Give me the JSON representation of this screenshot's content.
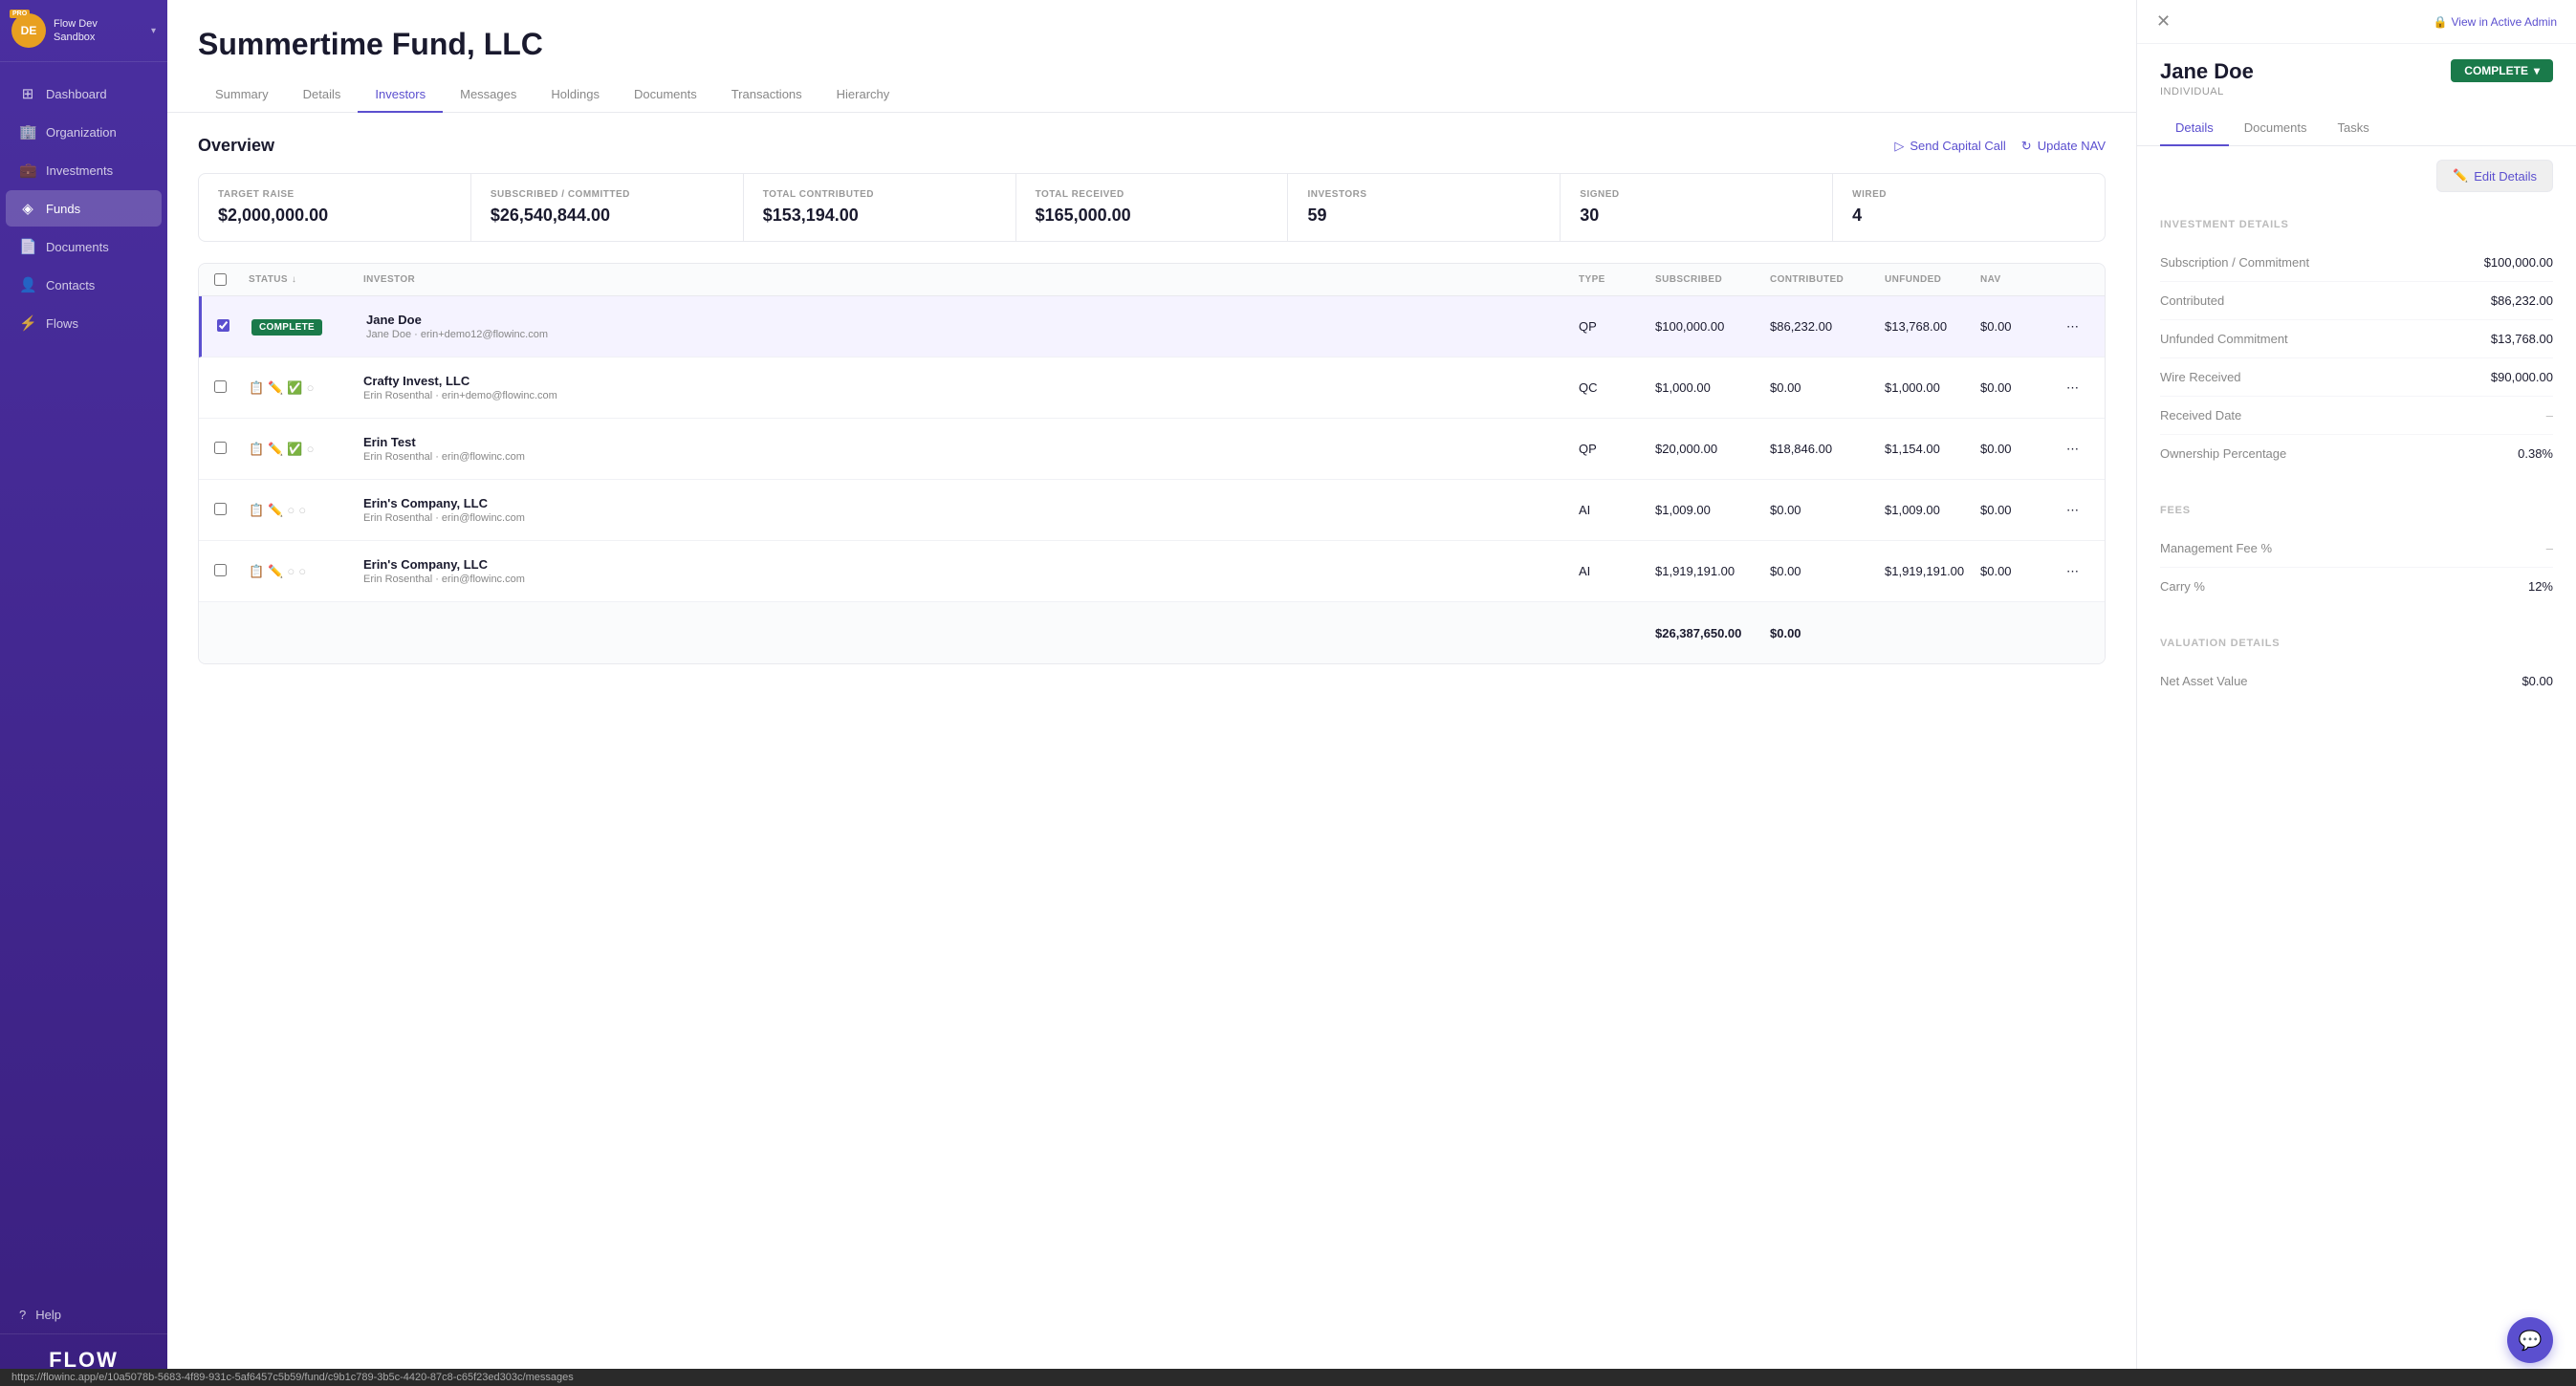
{
  "sidebar": {
    "org_label": "Flow Dev\nSandbox",
    "org_initials": "DE",
    "pro_badge": "PRO",
    "nav_items": [
      {
        "id": "dashboard",
        "label": "Dashboard",
        "icon": "⊞",
        "active": false
      },
      {
        "id": "organization",
        "label": "Organization",
        "icon": "🏢",
        "active": false
      },
      {
        "id": "investments",
        "label": "Investments",
        "icon": "💼",
        "active": false
      },
      {
        "id": "funds",
        "label": "Funds",
        "icon": "◈",
        "active": true
      },
      {
        "id": "documents",
        "label": "Documents",
        "icon": "📄",
        "active": false
      },
      {
        "id": "contacts",
        "label": "Contacts",
        "icon": "👤",
        "active": false
      },
      {
        "id": "flows",
        "label": "Flows",
        "icon": "⚡",
        "active": false
      }
    ],
    "help_label": "Help",
    "footer_logo": "FLOW"
  },
  "main": {
    "fund_title": "Summertime Fund, LLC",
    "tabs": [
      {
        "label": "Summary",
        "active": false
      },
      {
        "label": "Details",
        "active": false
      },
      {
        "label": "Investors",
        "active": true
      },
      {
        "label": "Messages",
        "active": false
      },
      {
        "label": "Holdings",
        "active": false
      },
      {
        "label": "Documents",
        "active": false
      },
      {
        "label": "Transactions",
        "active": false
      },
      {
        "label": "Hierarchy",
        "active": false
      }
    ],
    "overview_title": "Overview",
    "actions": [
      {
        "label": "Send Capital Call",
        "icon": "▷"
      },
      {
        "label": "Update NAV",
        "icon": "↻"
      }
    ],
    "stats": [
      {
        "label": "TARGET RAISE",
        "value": "$2,000,000.00"
      },
      {
        "label": "SUBSCRIBED / COMMITTED",
        "value": "$26,540,844.00"
      },
      {
        "label": "TOTAL CONTRIBUTED",
        "value": "$153,194.00"
      },
      {
        "label": "TOTAL RECEIVED",
        "value": "$165,000.00"
      },
      {
        "label": "INVESTORS",
        "value": "59"
      },
      {
        "label": "SIGNED",
        "value": "30"
      },
      {
        "label": "WIRED",
        "value": "4"
      }
    ],
    "table": {
      "columns": [
        "STATUS",
        "INVESTOR",
        "TYPE",
        "SUBSCRIBED",
        "CONTRIBUTED",
        "UNFUNDED",
        "NAV"
      ],
      "rows": [
        {
          "id": "jane-doe",
          "status": "COMPLETE",
          "status_type": "badge",
          "investor_name": "Jane Doe",
          "investor_email": "Jane Doe · erin+demo12@flowinc.com",
          "type": "QP",
          "subscribed": "$100,000.00",
          "contributed": "$86,232.00",
          "unfunded": "$13,768.00",
          "nav": "$0.00",
          "selected": true
        },
        {
          "id": "crafty-invest",
          "status": "icons",
          "investor_name": "Crafty Invest, LLC",
          "investor_email": "Erin Rosenthal · erin+demo@flowinc.com",
          "type": "QC",
          "subscribed": "$1,000.00",
          "contributed": "$0.00",
          "unfunded": "$1,000.00",
          "nav": "$0.00",
          "selected": false
        },
        {
          "id": "erin-test",
          "status": "icons",
          "investor_name": "Erin Test",
          "investor_email": "Erin Rosenthal · erin@flowinc.com",
          "type": "QP",
          "subscribed": "$20,000.00",
          "contributed": "$18,846.00",
          "unfunded": "$1,154.00",
          "nav": "$0.00",
          "selected": false
        },
        {
          "id": "erins-company-1",
          "status": "icons",
          "investor_name": "Erin's Company, LLC",
          "investor_email": "Erin Rosenthal · erin@flowinc.com",
          "type": "AI",
          "subscribed": "$1,009.00",
          "contributed": "$0.00",
          "unfunded": "$1,009.00",
          "nav": "$0.00",
          "selected": false
        },
        {
          "id": "erins-company-2",
          "status": "icons",
          "investor_name": "Erin's Company, LLC",
          "investor_email": "Erin Rosenthal · erin@flowinc.com",
          "type": "AI",
          "subscribed": "$1,919,191.00",
          "contributed": "$0.00",
          "unfunded": "$1,919,191.00",
          "nav": "$0.00",
          "selected": false
        }
      ],
      "footer_subscribed": "$26,387,650.00",
      "footer_contributed": "$0.00"
    }
  },
  "panel": {
    "person_name": "Jane Doe",
    "person_type": "INDIVIDUAL",
    "status": "COMPLETE",
    "tabs": [
      "Details",
      "Documents",
      "Tasks"
    ],
    "active_tab": "Details",
    "view_admin_label": "View in Active Admin",
    "edit_label": "Edit Details",
    "investment_details_title": "INVESTMENT DETAILS",
    "investment_details": [
      {
        "label": "Subscription / Commitment",
        "value": "$100,000.00"
      },
      {
        "label": "Contributed",
        "value": "$86,232.00"
      },
      {
        "label": "Unfunded Commitment",
        "value": "$13,768.00"
      },
      {
        "label": "Wire Received",
        "value": "$90,000.00"
      },
      {
        "label": "Received Date",
        "value": "–",
        "dash": true
      },
      {
        "label": "Ownership Percentage",
        "value": "0.38%"
      }
    ],
    "fees_title": "FEES",
    "fees": [
      {
        "label": "Management Fee %",
        "value": "–",
        "dash": true
      },
      {
        "label": "Carry %",
        "value": "12%"
      }
    ],
    "valuation_title": "VALUATION DETAILS",
    "valuation": [
      {
        "label": "Net Asset Value",
        "value": "$0.00"
      }
    ]
  },
  "url_bar": "https://flowinc.app/e/10a5078b-5683-4f89-931c-5af6457c5b59/fund/c9b1c789-3b5c-4420-87c8-c65f23ed303c/messages"
}
